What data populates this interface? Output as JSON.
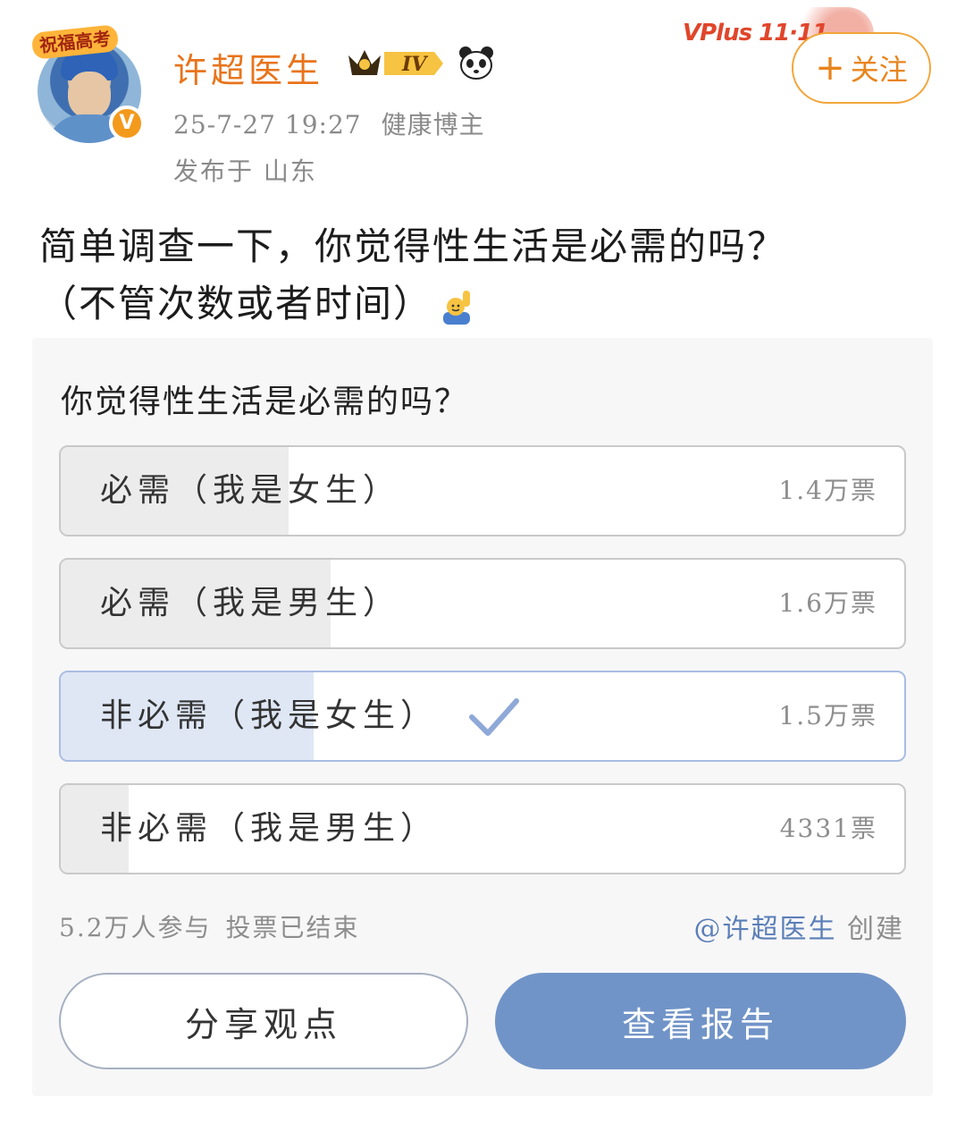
{
  "header": {
    "avatar_banner": "祝福高考",
    "username": "许超医生",
    "rank_badge": "IV",
    "timestamp": "25-7-27  19:27",
    "account_type": "健康博主",
    "location": "发布于  山东",
    "promo_label": "VPlus 11·11",
    "follow_label": "关注",
    "colors": {
      "username": "#e8741c",
      "follow_border": "#f2a53a"
    }
  },
  "post": {
    "line1": "简单调查一下，你觉得性生活是必需的吗？",
    "line2": "（不管次数或者时间）"
  },
  "poll": {
    "question": "你觉得性生活是必需的吗？",
    "options": [
      {
        "label": "必需（我是女生）",
        "count": "1.4万票",
        "fill_percent": 27,
        "selected": false
      },
      {
        "label": "必需（我是男生）",
        "count": "1.6万票",
        "fill_percent": 32,
        "selected": false
      },
      {
        "label": "非必需（我是女生）",
        "count": "1.5万票",
        "fill_percent": 30,
        "selected": true
      },
      {
        "label": "非必需（我是男生）",
        "count": "4331票",
        "fill_percent": 8,
        "selected": false
      }
    ],
    "participants": "5.2万人参与",
    "status": "投票已结束",
    "creator_mention": "@许超医生",
    "creator_suffix": "创建",
    "share_label": "分享观点",
    "report_label": "查看报告",
    "colors": {
      "selected_fill": "#dfe7f5",
      "report_button": "#7194c8",
      "check": "#8ea8d8"
    }
  }
}
